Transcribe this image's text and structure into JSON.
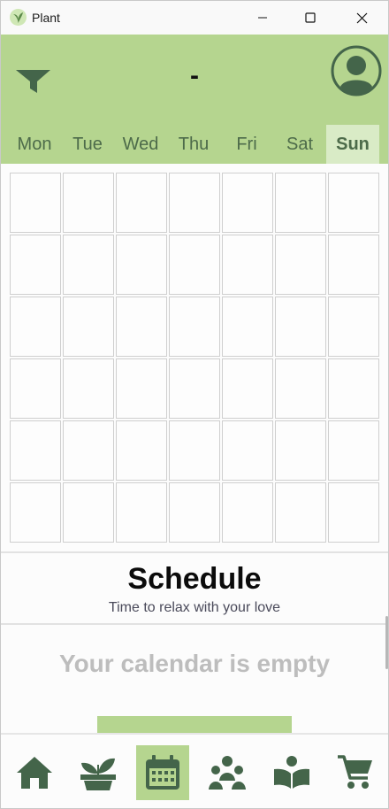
{
  "window": {
    "title": "Plant",
    "controls": [
      "minimize-icon",
      "maximize-icon",
      "close-icon"
    ]
  },
  "header": {
    "title": "-",
    "filter_icon": "filter-icon",
    "profile_icon": "account-circle-icon"
  },
  "days": [
    {
      "label": "Mon",
      "active": false
    },
    {
      "label": "Tue",
      "active": false
    },
    {
      "label": "Wed",
      "active": false
    },
    {
      "label": "Thu",
      "active": false
    },
    {
      "label": "Fri",
      "active": false
    },
    {
      "label": "Sat",
      "active": false
    },
    {
      "label": "Sun",
      "active": true
    }
  ],
  "calendar": {
    "rows": 6,
    "columns": 7
  },
  "schedule": {
    "title": "Schedule",
    "subtitle": "Time to relax with your love",
    "empty_message": "Your calendar is empty"
  },
  "nav": [
    {
      "icon": "home-icon",
      "active": false
    },
    {
      "icon": "potted-plant-icon",
      "active": false
    },
    {
      "icon": "calendar-icon",
      "active": true
    },
    {
      "icon": "group-icon",
      "active": false
    },
    {
      "icon": "open-book-icon",
      "active": false
    },
    {
      "icon": "shopping-cart-icon",
      "active": false
    }
  ],
  "colors": {
    "header_green": "#b5d58f",
    "active_tab": "#d9ebc6",
    "dark_green": "#44654a",
    "muted_text": "#bdbdbd"
  }
}
